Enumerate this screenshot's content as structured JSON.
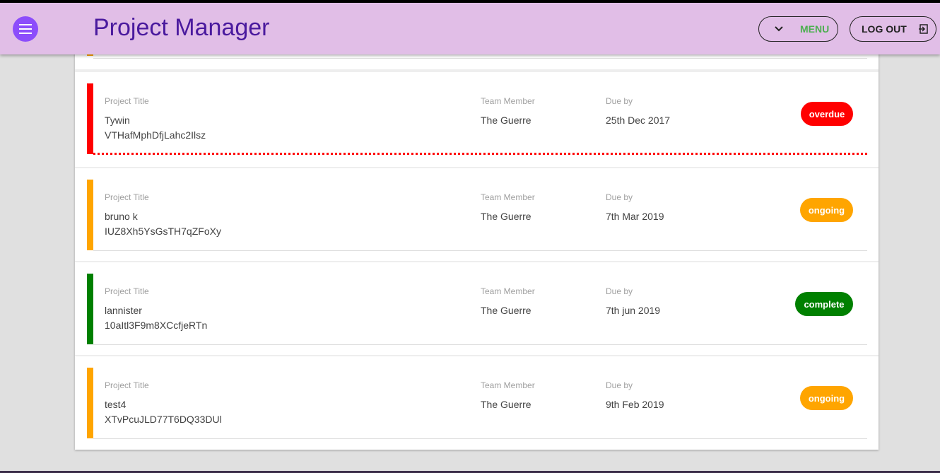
{
  "header": {
    "title": "Project Manager",
    "menu_label": "MENU",
    "logout_label": "LOG OUT",
    "menu_icon": "hamburger-icon",
    "menu_chevron_icon": "chevron-down-icon",
    "logout_icon": "exit-icon"
  },
  "colors": {
    "header_bg": "#e1bee7",
    "title": "#4a1a9e",
    "hamburger": "#8c4dfb",
    "overdue": "#ff0000",
    "ongoing": "#ffa500",
    "complete": "#008000",
    "menu_text": "#4caf50"
  },
  "labels": {
    "project_title": "Project Title",
    "team_member": "Team Member",
    "due_by": "Due by"
  },
  "projects": [
    {
      "name": "Tywin",
      "id": "VTHafMphDfjLahc2Ilsz",
      "member": "The Guerre",
      "due": "25th Dec 2017",
      "status": "overdue"
    },
    {
      "name": "bruno k",
      "id": "IUZ8Xh5YsGsTH7qZFoXy",
      "member": "The Guerre",
      "due": "7th Mar 2019",
      "status": "ongoing"
    },
    {
      "name": "lannister",
      "id": "10aItl3F9m8XCcfjeRTn",
      "member": "The Guerre",
      "due": "7th jun 2019",
      "status": "complete"
    },
    {
      "name": "test4",
      "id": "XTvPcuJLD77T6DQ33DUl",
      "member": "The Guerre",
      "due": "9th Feb 2019",
      "status": "ongoing"
    }
  ]
}
